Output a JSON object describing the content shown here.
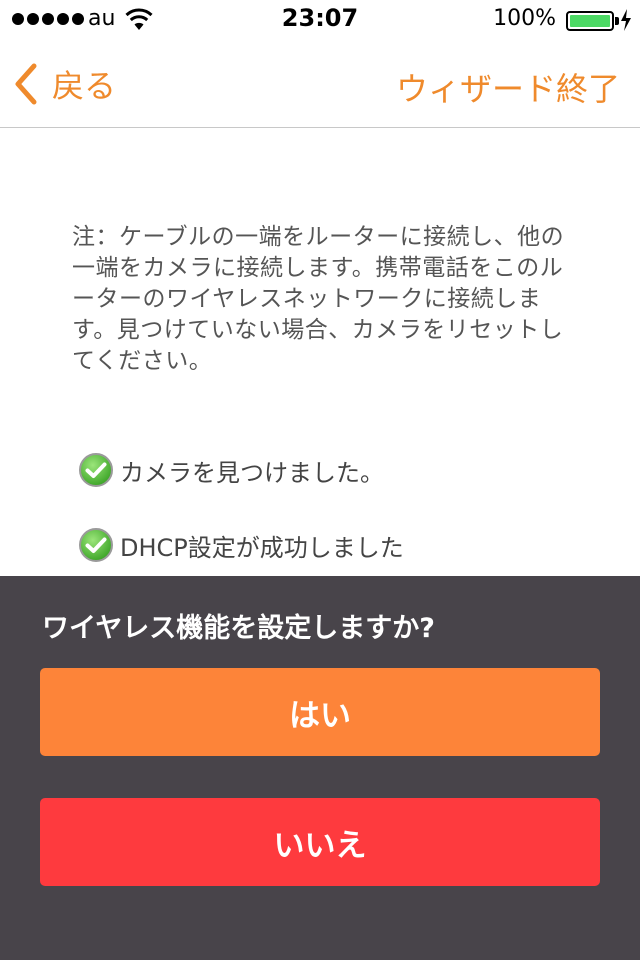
{
  "status_bar": {
    "carrier": "au",
    "time": "23:07",
    "battery_percent": "100%",
    "battery_color": "#4cd964"
  },
  "nav": {
    "back_label": "戻る",
    "finish_label": "ウィザード終了",
    "accent_color": "#ef8a2c"
  },
  "content": {
    "note": "注：ケーブルの一端をルーターに接続し、他の一端をカメラに接続します。携帯電話をこのルーターのワイヤレスネットワークに接続します。見つけていない場合、カメラをリセットしてください。",
    "checks": [
      {
        "label": "カメラを見つけました。",
        "icon": "check-circle-icon"
      },
      {
        "label": "DHCP設定が成功しました",
        "icon": "check-circle-icon"
      }
    ]
  },
  "sheet": {
    "title": "ワイヤレス機能を設定しますか?",
    "yes_label": "はい",
    "no_label": "いいえ",
    "yes_color": "#fd8439",
    "no_color": "#fe3a3e",
    "background": "#48444a"
  }
}
